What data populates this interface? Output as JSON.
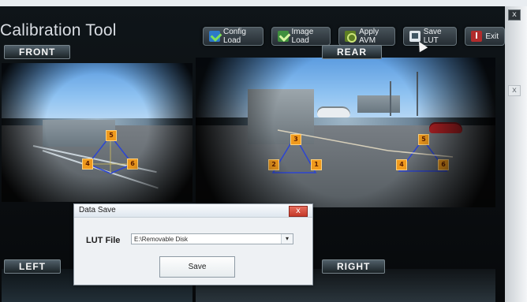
{
  "window": {
    "title": "Calibration Tool",
    "close_icon": "x-close-icon",
    "outer_close_label": "x"
  },
  "toolbar": {
    "config_label": "Config Load",
    "image_label": "Image Load",
    "apply_label": "Apply AVM",
    "save_lut_label": "Save LUT",
    "exit_label": "Exit"
  },
  "views": {
    "front": "FRONT",
    "rear": "REAR",
    "left": "LEFT",
    "right": "RIGHT"
  },
  "markers": {
    "front": [
      "5",
      "4",
      "6"
    ],
    "rear": [
      "3",
      "2",
      "1",
      "5",
      "4",
      "6"
    ]
  },
  "dialog": {
    "title": "Data Save",
    "lut_label": "LUT File",
    "lut_value": "E:\\Removable Disk",
    "save_label": "Save",
    "close_label": "x"
  },
  "colors": {
    "marker": "#f09a1d",
    "calibration_line": "#2c45d2"
  }
}
